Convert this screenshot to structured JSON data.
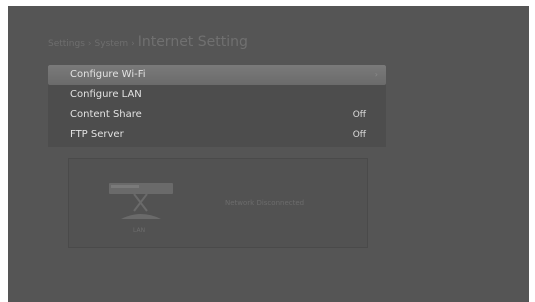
{
  "breadcrumb": {
    "level1": "Settings",
    "level2": "System",
    "current": "Internet Setting",
    "separator": "›"
  },
  "menu": {
    "items": [
      {
        "label": "Configure Wi-Fi",
        "value": "",
        "selected": true
      },
      {
        "label": "Configure LAN",
        "value": "",
        "selected": false
      },
      {
        "label": "Content Share",
        "value": "Off",
        "selected": false
      },
      {
        "label": "FTP Server",
        "value": "Off",
        "selected": false
      }
    ],
    "selected_arrow": "›"
  },
  "network": {
    "device_label": "LAN",
    "status": "Network Disconnected"
  },
  "colors": {
    "background": "#555555",
    "selected_row": "#747474",
    "text": "#e2e2e2",
    "dim_text": "#6e6e6e"
  }
}
